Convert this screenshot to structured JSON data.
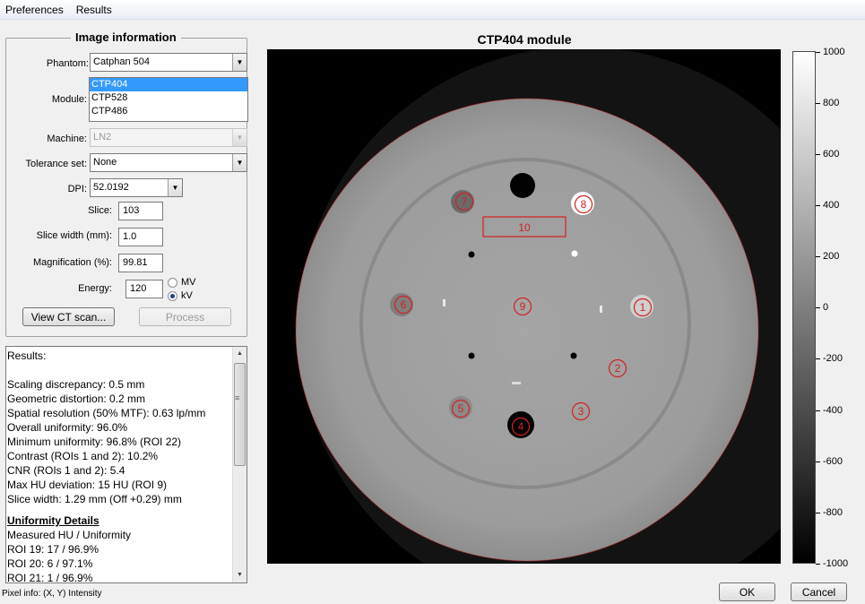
{
  "menu": [
    "Preferences",
    "Results"
  ],
  "panel": {
    "title": "Image information",
    "phantom": {
      "label": "Phantom:",
      "value": "Catphan 504"
    },
    "module": {
      "label": "Module:",
      "options": [
        "CTP404",
        "CTP528",
        "CTP486"
      ],
      "selected": "CTP404"
    },
    "machine": {
      "label": "Machine:",
      "value": "LN2"
    },
    "tolerance": {
      "label": "Tolerance set:",
      "value": "None"
    },
    "dpi": {
      "label": "DPI:",
      "value": "52.0192"
    },
    "slice": {
      "label": "Slice:",
      "value": "103"
    },
    "slice_width": {
      "label": "Slice width (mm):",
      "value": "1.0"
    },
    "magnification": {
      "label": "Magnification (%):",
      "value": "99.81"
    },
    "energy": {
      "label": "Energy:",
      "value": "120",
      "mv": "MV",
      "kv": "kV",
      "selected": "kV"
    },
    "view_button": "View CT scan...",
    "process_button": "Process"
  },
  "results": {
    "title": "Results:",
    "lines": [
      "Scaling discrepancy: 0.5 mm",
      "Geometric distortion: 0.2 mm",
      "Spatial resolution (50% MTF): 0.63 lp/mm",
      "Overall uniformity: 96.0%",
      "Minimum uniformity: 96.8% (ROI 22)",
      "Contrast (ROIs 1 and 2): 10.2%",
      "CNR (ROIs 1 and 2): 5.4",
      "Max HU deviation: 15 HU (ROI 9)",
      "Slice width: 1.29 mm (Off +0.29) mm"
    ],
    "uniformity_heading": "Uniformity Details",
    "uniformity_lines": [
      "Measured HU / Uniformity",
      "ROI 19: 17 / 96.9%",
      "ROI 20: 6 / 97.1%",
      "ROI 21: 1 / 96.9%"
    ]
  },
  "status": "Pixel info:  (X, Y)  Intensity",
  "plot": {
    "title": "CTP404 module",
    "roi_labels": [
      "1",
      "2",
      "3",
      "4",
      "5",
      "6",
      "7",
      "8",
      "9",
      "10"
    ],
    "colorbar_ticks": [
      "1000",
      "800",
      "600",
      "400",
      "200",
      "0",
      "-200",
      "-400",
      "-600",
      "-800",
      "-1000"
    ],
    "roi_color": "#d42020"
  },
  "buttons": {
    "ok": "OK",
    "cancel": "Cancel"
  }
}
